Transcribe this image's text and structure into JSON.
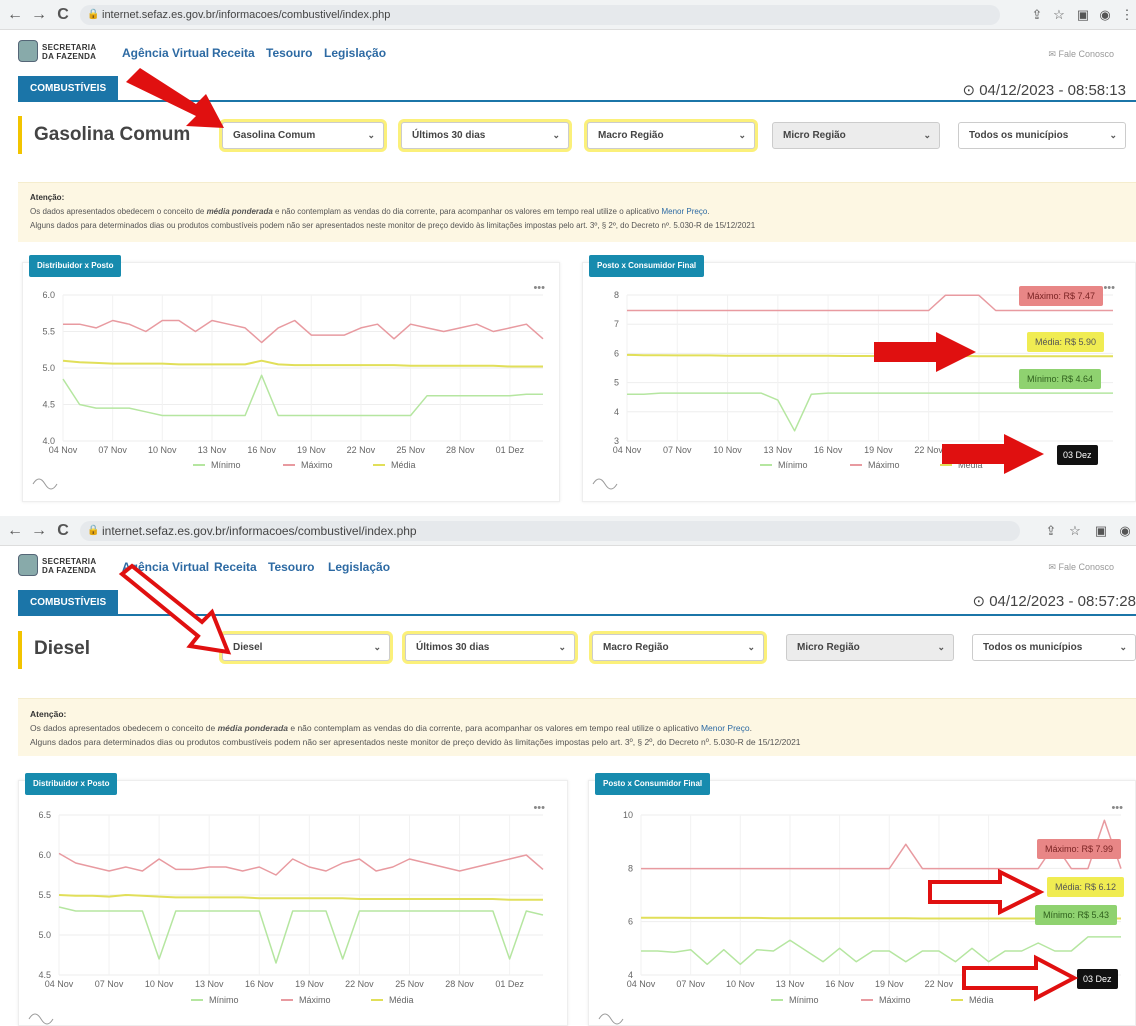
{
  "browser": {
    "back": "←",
    "forward": "→",
    "reload": "C",
    "lock": "🔒",
    "url": "internet.sefaz.es.gov.br/informacoes/combustivel/index.php",
    "icons": [
      "share-icon",
      "star-icon",
      "tab-icon",
      "profile-icon",
      "menu-icon"
    ]
  },
  "header": {
    "logo_line1": "SECRETARIA",
    "logo_line2": "DA FAZENDA",
    "nav": [
      "Agência Virtual",
      "Receita",
      "Tesouro",
      "Legislação"
    ],
    "fale": "Fale Conosco"
  },
  "tab_label": "COMBUSTÍVEIS",
  "filters": {
    "period": "Últimos 30 dias",
    "macro": "Macro Região",
    "micro": "Micro Região",
    "municipios": "Todos os municípios",
    "chevron": "⌄"
  },
  "notice": {
    "title": "Atenção:",
    "line1_a": "Os dados apresentados obedecem o conceito de ",
    "line1_b": "média ponderada",
    "line1_c": " e não contemplam as vendas do dia corrente, para acompanhar os valores em tempo real utilize o aplicativo ",
    "line1_link": "Menor Preço",
    "line1_end": ".",
    "line2": "Alguns dados para determinados dias ou produtos combustíveis podem não ser apresentados neste monitor de preço devido às limitações impostas pelo art. 3º, § 2º, do Decreto nº. 5.030-R de 15/12/2021"
  },
  "colors": {
    "accent": "#1b75a8",
    "card_title": "#178bae",
    "minimo": "#b5e6a0",
    "maximo": "#e89aa0",
    "media": "#e1df59",
    "highlight": "#fbf07a",
    "arrow": "#e01010"
  },
  "legend": [
    "Mínimo",
    "Máximo",
    "Média"
  ],
  "screens": [
    {
      "datetime": "⊙ 04/12/2023 - 08:58:13",
      "fuel_title": "Gasolina Comum",
      "fuel_select": "Gasolina Comum",
      "cards": {
        "left_title": "Distribuidor x Posto",
        "right_title": "Posto x Consumidor Final",
        "tip_max": "Máximo: R$ 7.47",
        "tip_med": "Média: R$ 5.90",
        "tip_min": "Mínimo: R$ 4.64",
        "tip_date": "03 Dez"
      }
    },
    {
      "datetime": "⊙ 04/12/2023 - 08:57:28",
      "fuel_title": "Diesel",
      "fuel_select": "Diesel",
      "cards": {
        "left_title": "Distribuidor x Posto",
        "right_title": "Posto x Consumidor Final",
        "tip_max": "Máximo: R$ 7.99",
        "tip_med": "Média: R$ 6.12",
        "tip_min": "Mínimo: R$ 5.43",
        "tip_date": "03 Dez"
      }
    }
  ],
  "chart_data": [
    {
      "id": "gas_left",
      "type": "line",
      "title": "Distribuidor x Posto",
      "x": [
        "04 Nov",
        "05 Nov",
        "06 Nov",
        "07 Nov",
        "08 Nov",
        "09 Nov",
        "10 Nov",
        "11 Nov",
        "12 Nov",
        "13 Nov",
        "14 Nov",
        "15 Nov",
        "16 Nov",
        "17 Nov",
        "18 Nov",
        "19 Nov",
        "20 Nov",
        "21 Nov",
        "22 Nov",
        "23 Nov",
        "24 Nov",
        "25 Nov",
        "26 Nov",
        "27 Nov",
        "28 Nov",
        "29 Nov",
        "30 Nov",
        "01 Dez",
        "02 Dez",
        "03 Dez"
      ],
      "xticks": [
        "04 Nov",
        "07 Nov",
        "10 Nov",
        "13 Nov",
        "16 Nov",
        "19 Nov",
        "22 Nov",
        "25 Nov",
        "28 Nov",
        "01 Dez"
      ],
      "ylim": [
        4.0,
        6.0
      ],
      "yticks": [
        "6.0",
        "5.5",
        "5.0",
        "4.5",
        "4.0"
      ],
      "series": [
        {
          "name": "Máximo",
          "values": [
            5.6,
            5.6,
            5.55,
            5.65,
            5.6,
            5.5,
            5.65,
            5.65,
            5.5,
            5.65,
            5.6,
            5.55,
            5.35,
            5.55,
            5.65,
            5.45,
            5.45,
            5.45,
            5.55,
            5.6,
            5.4,
            5.6,
            5.55,
            5.5,
            5.55,
            5.6,
            5.5,
            5.55,
            5.6,
            5.4
          ]
        },
        {
          "name": "Média",
          "values": [
            5.1,
            5.08,
            5.07,
            5.06,
            5.06,
            5.06,
            5.06,
            5.05,
            5.05,
            5.05,
            5.05,
            5.05,
            5.1,
            5.05,
            5.04,
            5.04,
            5.04,
            5.04,
            5.04,
            5.04,
            5.04,
            5.03,
            5.03,
            5.03,
            5.03,
            5.03,
            5.03,
            5.02,
            5.02,
            5.02
          ]
        },
        {
          "name": "Mínimo",
          "values": [
            4.85,
            4.5,
            4.45,
            4.45,
            4.45,
            4.4,
            4.35,
            4.35,
            4.35,
            4.35,
            4.35,
            4.35,
            4.9,
            4.35,
            4.35,
            4.35,
            4.35,
            4.35,
            4.35,
            4.35,
            4.35,
            4.35,
            4.62,
            4.62,
            4.62,
            4.62,
            4.62,
            4.62,
            4.64,
            4.64
          ]
        }
      ]
    },
    {
      "id": "gas_right",
      "type": "line",
      "title": "Posto x Consumidor Final",
      "x": [
        "04 Nov",
        "05 Nov",
        "06 Nov",
        "07 Nov",
        "08 Nov",
        "09 Nov",
        "10 Nov",
        "11 Nov",
        "12 Nov",
        "13 Nov",
        "14 Nov",
        "15 Nov",
        "16 Nov",
        "17 Nov",
        "18 Nov",
        "19 Nov",
        "20 Nov",
        "21 Nov",
        "22 Nov",
        "23 Nov",
        "24 Nov",
        "25 Nov",
        "26 Nov",
        "27 Nov",
        "28 Nov",
        "29 Nov",
        "30 Nov",
        "01 Dez",
        "02 Dez",
        "03 Dez"
      ],
      "xticks": [
        "04 Nov",
        "07 Nov",
        "10 Nov",
        "13 Nov",
        "16 Nov",
        "19 Nov",
        "22 Nov",
        "1 Dez"
      ],
      "ylim": [
        3,
        8
      ],
      "yticks": [
        "8",
        "7",
        "6",
        "5",
        "4",
        "3"
      ],
      "series": [
        {
          "name": "Máximo",
          "values": [
            7.47,
            7.47,
            7.47,
            7.47,
            7.47,
            7.47,
            7.47,
            7.47,
            7.47,
            7.47,
            7.47,
            7.47,
            7.47,
            7.47,
            7.47,
            7.47,
            7.47,
            7.47,
            7.47,
            7.99,
            7.99,
            7.99,
            7.47,
            7.47,
            7.47,
            7.47,
            7.47,
            7.47,
            7.47,
            7.47
          ]
        },
        {
          "name": "Média",
          "values": [
            5.95,
            5.94,
            5.94,
            5.93,
            5.93,
            5.93,
            5.92,
            5.92,
            5.92,
            5.92,
            5.92,
            5.92,
            5.92,
            5.91,
            5.91,
            5.91,
            5.91,
            5.91,
            5.91,
            5.91,
            5.91,
            5.9,
            5.9,
            5.9,
            5.9,
            5.9,
            5.9,
            5.9,
            5.9,
            5.9
          ]
        },
        {
          "name": "Mínimo",
          "values": [
            4.6,
            4.6,
            4.64,
            4.64,
            4.64,
            4.64,
            4.64,
            4.64,
            4.64,
            4.4,
            3.35,
            4.6,
            4.64,
            4.64,
            4.64,
            4.64,
            4.64,
            4.64,
            4.64,
            4.64,
            4.64,
            4.64,
            4.64,
            4.64,
            4.64,
            4.64,
            4.64,
            4.64,
            4.64,
            4.64
          ]
        }
      ]
    },
    {
      "id": "diesel_left",
      "type": "line",
      "title": "Distribuidor x Posto",
      "x": [
        "04 Nov",
        "05 Nov",
        "06 Nov",
        "07 Nov",
        "08 Nov",
        "09 Nov",
        "10 Nov",
        "11 Nov",
        "12 Nov",
        "13 Nov",
        "14 Nov",
        "15 Nov",
        "16 Nov",
        "17 Nov",
        "18 Nov",
        "19 Nov",
        "20 Nov",
        "21 Nov",
        "22 Nov",
        "23 Nov",
        "24 Nov",
        "25 Nov",
        "26 Nov",
        "27 Nov",
        "28 Nov",
        "29 Nov",
        "30 Nov",
        "01 Dez",
        "02 Dez",
        "03 Dez"
      ],
      "xticks": [
        "04 Nov",
        "07 Nov",
        "10 Nov",
        "13 Nov",
        "16 Nov",
        "19 Nov",
        "22 Nov",
        "25 Nov",
        "28 Nov",
        "01 Dez"
      ],
      "ylim": [
        4.5,
        6.5
      ],
      "yticks": [
        "6.5",
        "6.0",
        "5.5",
        "5.0",
        "4.5"
      ],
      "series": [
        {
          "name": "Máximo",
          "values": [
            6.02,
            5.9,
            5.85,
            5.8,
            5.85,
            5.8,
            5.95,
            5.82,
            5.82,
            5.85,
            5.85,
            5.8,
            5.85,
            5.75,
            5.95,
            5.85,
            5.8,
            5.9,
            5.95,
            5.8,
            5.85,
            5.95,
            5.9,
            5.85,
            5.8,
            5.85,
            5.9,
            5.95,
            6.0,
            5.82
          ]
        },
        {
          "name": "Média",
          "values": [
            5.5,
            5.49,
            5.49,
            5.48,
            5.5,
            5.49,
            5.48,
            5.47,
            5.47,
            5.47,
            5.47,
            5.47,
            5.46,
            5.46,
            5.46,
            5.46,
            5.46,
            5.46,
            5.45,
            5.45,
            5.45,
            5.45,
            5.45,
            5.45,
            5.45,
            5.45,
            5.45,
            5.44,
            5.44,
            5.44
          ]
        },
        {
          "name": "Mínimo",
          "values": [
            5.35,
            5.3,
            5.3,
            5.3,
            5.3,
            5.3,
            4.7,
            5.3,
            5.3,
            5.3,
            5.3,
            5.3,
            5.3,
            4.65,
            5.3,
            5.3,
            5.3,
            4.7,
            5.3,
            5.3,
            5.3,
            5.3,
            5.3,
            5.3,
            5.3,
            5.3,
            5.3,
            4.7,
            5.3,
            5.25
          ]
        }
      ]
    },
    {
      "id": "diesel_right",
      "type": "line",
      "title": "Posto x Consumidor Final",
      "x": [
        "04 Nov",
        "05 Nov",
        "06 Nov",
        "07 Nov",
        "08 Nov",
        "09 Nov",
        "10 Nov",
        "11 Nov",
        "12 Nov",
        "13 Nov",
        "14 Nov",
        "15 Nov",
        "16 Nov",
        "17 Nov",
        "18 Nov",
        "19 Nov",
        "20 Nov",
        "21 Nov",
        "22 Nov",
        "23 Nov",
        "24 Nov",
        "25 Nov",
        "26 Nov",
        "27 Nov",
        "28 Nov",
        "29 Nov",
        "30 Nov",
        "01 Dez",
        "02 Dez",
        "03 Dez"
      ],
      "xticks": [
        "04 Nov",
        "07 Nov",
        "10 Nov",
        "13 Nov",
        "16 Nov",
        "19 Nov",
        "22 Nov",
        "Dez"
      ],
      "ylim": [
        4,
        10
      ],
      "yticks": [
        "10",
        "8",
        "6",
        "4"
      ],
      "series": [
        {
          "name": "Máximo",
          "values": [
            7.99,
            7.99,
            7.99,
            7.99,
            7.99,
            7.99,
            7.99,
            7.99,
            7.99,
            7.99,
            7.99,
            7.99,
            7.99,
            7.99,
            7.99,
            7.99,
            8.9,
            7.99,
            7.99,
            7.99,
            7.99,
            7.99,
            7.99,
            7.99,
            7.99,
            8.9,
            7.99,
            7.99,
            9.8,
            7.99
          ]
        },
        {
          "name": "Média",
          "values": [
            6.15,
            6.15,
            6.15,
            6.14,
            6.14,
            6.14,
            6.14,
            6.14,
            6.13,
            6.13,
            6.13,
            6.13,
            6.13,
            6.13,
            6.13,
            6.13,
            6.13,
            6.12,
            6.12,
            6.12,
            6.12,
            6.12,
            6.12,
            6.12,
            6.12,
            6.12,
            6.12,
            6.12,
            6.12,
            6.12
          ]
        },
        {
          "name": "Mínimo",
          "values": [
            4.9,
            4.9,
            4.85,
            4.95,
            4.4,
            4.95,
            4.4,
            4.95,
            4.9,
            5.3,
            4.9,
            4.5,
            5.0,
            4.5,
            4.9,
            4.9,
            4.5,
            4.9,
            4.9,
            4.5,
            5.0,
            4.5,
            4.9,
            4.9,
            5.2,
            4.9,
            4.9,
            5.43,
            5.43,
            5.43
          ]
        }
      ]
    }
  ]
}
